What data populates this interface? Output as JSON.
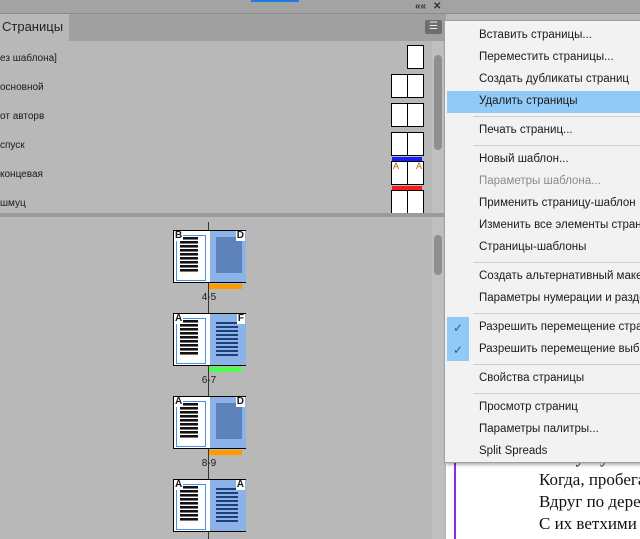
{
  "panel": {
    "tab": "Страницы",
    "collapse_icon": "««",
    "close_icon": "✕"
  },
  "masters": [
    {
      "label": "ез шаблона]",
      "pages": 1,
      "letters": [],
      "bar": null
    },
    {
      "label": "основной",
      "pages": 2,
      "letters": [],
      "bar": null
    },
    {
      "label": "от авторв",
      "pages": 2,
      "letters": [],
      "bar": null
    },
    {
      "label": "спуск",
      "pages": 2,
      "letters": [],
      "bar": "#1a1aff"
    },
    {
      "label": "концевая",
      "pages": 2,
      "letters": [
        "A",
        "A"
      ],
      "bar": "#ff1a1a"
    },
    {
      "label": "шмуц",
      "pages": 2,
      "letters": [],
      "bar": null
    }
  ],
  "spreads": [
    {
      "left": "B",
      "right": "D",
      "label": "4-5",
      "color": "#ff9900",
      "right_kind": "image"
    },
    {
      "left": "A",
      "right": "F",
      "label": "6-7",
      "color": "#4dff4d",
      "right_kind": "text"
    },
    {
      "left": "A",
      "right": "D",
      "label": "8-9",
      "color": "#ff9900",
      "right_kind": "image"
    },
    {
      "left": "A",
      "right": "A",
      "label": "",
      "color": null,
      "right_kind": "text"
    }
  ],
  "menu": [
    {
      "label": "Вставить страницы..."
    },
    {
      "label": "Переместить страницы..."
    },
    {
      "label": "Создать дубликаты страниц"
    },
    {
      "label": "Удалить страницы",
      "highlighted": true
    },
    {
      "sep": true
    },
    {
      "label": "Печать страниц..."
    },
    {
      "sep": true
    },
    {
      "label": "Новый шаблон..."
    },
    {
      "label": "Параметры шаблона...",
      "disabled": true
    },
    {
      "label": "Применить страницу-шаблон"
    },
    {
      "label": "Изменить все элементы страниц"
    },
    {
      "label": "Страницы-шаблоны"
    },
    {
      "sep": true
    },
    {
      "label": "Создать альтернативный макет"
    },
    {
      "label": "Параметры нумерации и разделов"
    },
    {
      "sep": true
    },
    {
      "label": "Разрешить перемещение страниц",
      "checked": true
    },
    {
      "label": "Разрешить перемещение выбранного разворота",
      "checked": true
    },
    {
      "sep": true
    },
    {
      "label": "Свойства страницы"
    },
    {
      "sep": true
    },
    {
      "label": "Просмотр страниц"
    },
    {
      "label": "Параметры палитры..."
    },
    {
      "label": "Split Spreads"
    }
  ],
  "document": {
    "lines": [
      "Гляжу с участием",
      "Когда, пробегая",
      "Вдруг по деревне",
      "С их ветхими"
    ]
  }
}
